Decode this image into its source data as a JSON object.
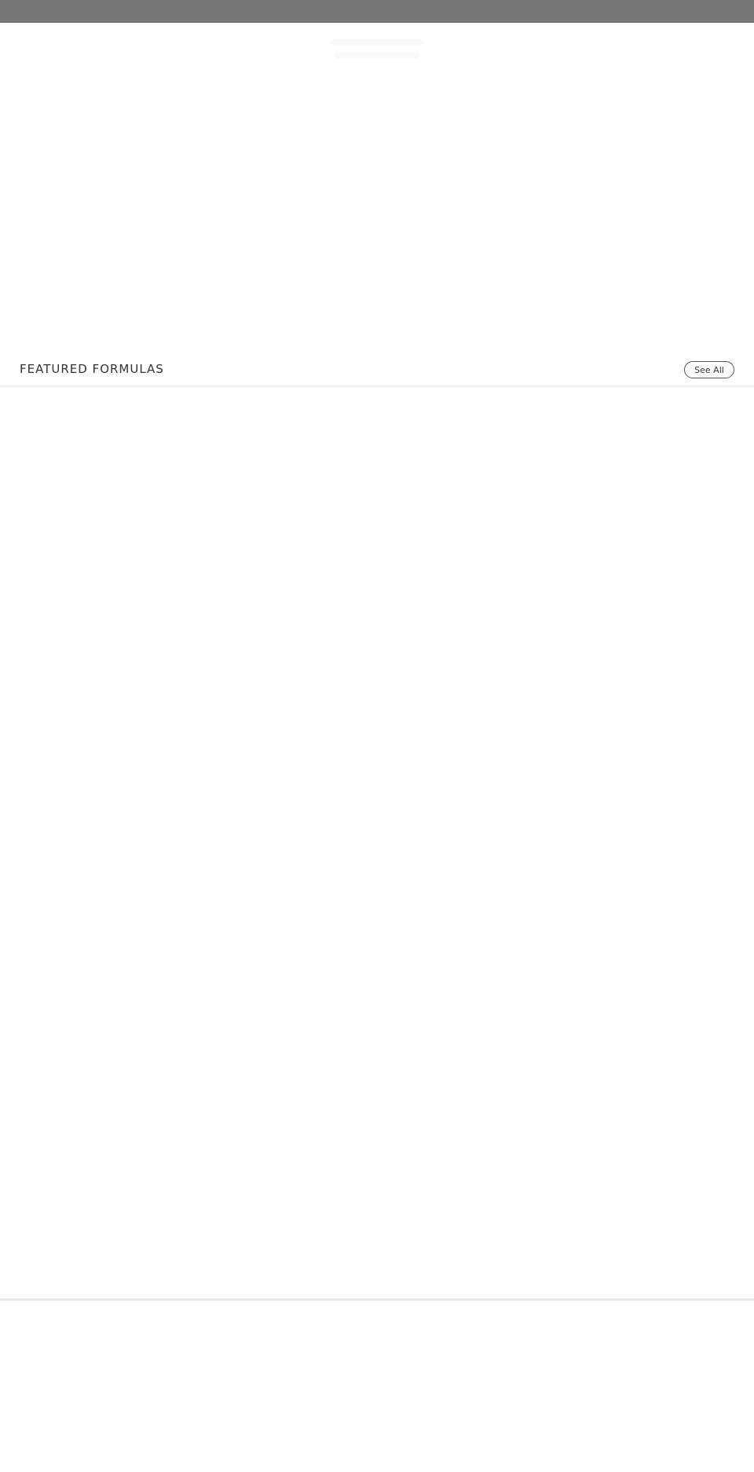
{
  "featured": {
    "title": "FEATURED FORMULAS",
    "see_all_label": "See All"
  },
  "colors": {
    "top_bar": "#777777",
    "divider": "#eaeaea",
    "button_border": "#555555"
  }
}
